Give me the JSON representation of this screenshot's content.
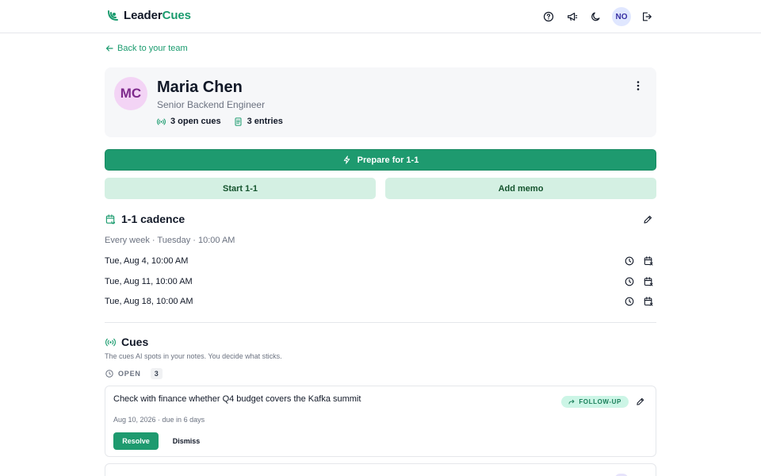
{
  "app": {
    "brand_prefix": "Leader",
    "brand_suffix": "Cues",
    "brand_color": "#1a9b6e",
    "header_icons": [
      "help-icon",
      "megaphone-icon",
      "moon-icon"
    ],
    "user_initials": "NO",
    "logout_icon": "logout-icon"
  },
  "nav": {
    "back_label": "Back to your team"
  },
  "profile": {
    "initials": "MC",
    "name": "Maria Chen",
    "role": "Senior Backend Engineer",
    "open_cues": "3 open cues",
    "entries": "3 entries"
  },
  "actions": {
    "prepare_label": "Prepare for 1-1",
    "start_label": "Start 1-1",
    "memo_label": "Add memo"
  },
  "cadence": {
    "title": "1-1 cadence",
    "schedule": "Every week · Tuesday · 10:00 AM",
    "sessions": [
      {
        "date": "Tue, Aug 4, 10:00 AM"
      },
      {
        "date": "Tue, Aug 11, 10:00 AM"
      },
      {
        "date": "Tue, Aug 18, 10:00 AM"
      }
    ]
  },
  "cues": {
    "title": "Cues",
    "subtitle": "The cues AI spots in your notes. You decide what sticks.",
    "open_label": "OPEN",
    "open_count": "3",
    "items": [
      {
        "text": "Check with finance whether Q4 budget covers the Kafka summit",
        "tag": "FOLLOW-UP",
        "meta": "Aug 10, 2026 · due in 6 days",
        "resolve_label": "Resolve",
        "dismiss_label": "Dismiss"
      }
    ]
  },
  "colors": {
    "primary": "#1e9a6f",
    "soft": "#d4f0e3",
    "tag_followup_bg": "#ccf5e6",
    "avatar_bg": "#f3d4f5"
  }
}
